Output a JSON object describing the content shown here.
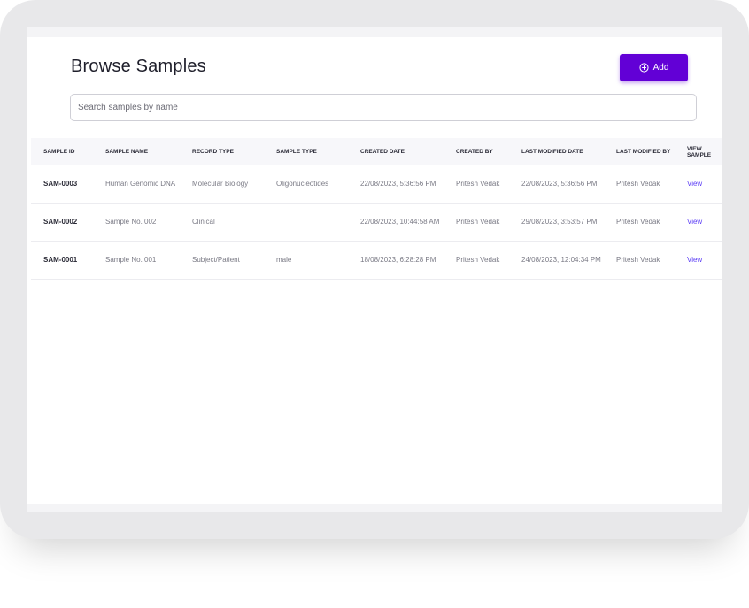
{
  "page": {
    "title": "Browse Samples"
  },
  "toolbar": {
    "add_label": "Add",
    "add_icon": "plus-circle-icon"
  },
  "search": {
    "placeholder": "Search samples by name",
    "value": ""
  },
  "table": {
    "headers": [
      "SAMPLE ID",
      "SAMPLE NAME",
      "RECORD TYPE",
      "SAMPLE TYPE",
      "CREATED DATE",
      "CREATED BY",
      "LAST MODIFIED DATE",
      "LAST MODIFIED BY",
      "VIEW SAMPLE"
    ],
    "rows": [
      [
        "SAM-0003",
        "Human Genomic DNA",
        "Molecular Biology",
        "Oligonucleotides",
        "22/08/2023, 5:36:56 PM",
        "Pritesh Vedak",
        "22/08/2023, 5:36:56 PM",
        "Pritesh Vedak",
        "View"
      ],
      [
        "SAM-0002",
        "Sample No. 002",
        "Clinical",
        "",
        "22/08/2023, 10:44:58 AM",
        "Pritesh Vedak",
        "29/08/2023, 3:53:57 PM",
        "Pritesh Vedak",
        "View"
      ],
      [
        "SAM-0001",
        "Sample No. 001",
        "Subject/Patient",
        "male",
        "18/08/2023, 6:28:28 PM",
        "Pritesh Vedak",
        "24/08/2023, 12:04:34 PM",
        "Pritesh Vedak",
        "View"
      ]
    ]
  },
  "colors": {
    "accent": "#6200d6",
    "link": "#5b3df5"
  }
}
